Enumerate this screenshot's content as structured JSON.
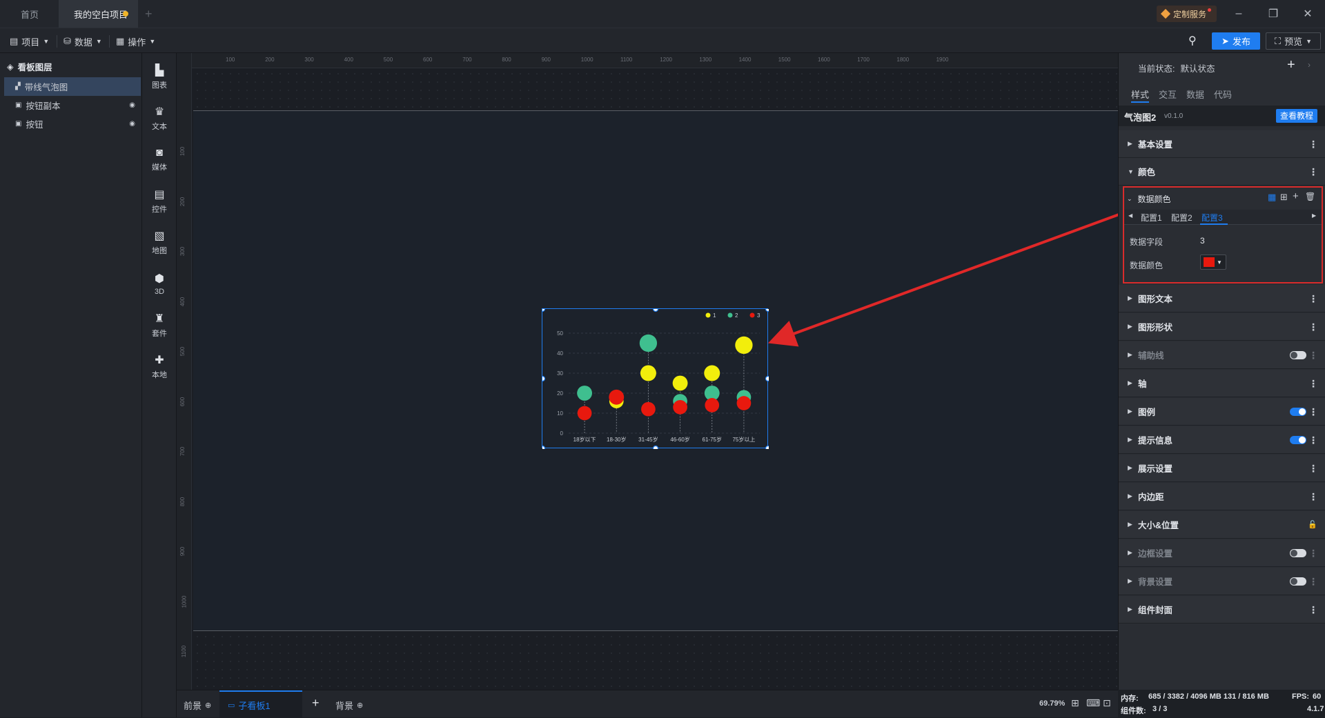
{
  "tabs": [
    {
      "label": "首页"
    },
    {
      "label": "我的空白项目"
    }
  ],
  "titlebar": {
    "custom_service": "定制服务"
  },
  "toolbar": {
    "project": "项目",
    "data": "数据",
    "operation": "操作",
    "publish": "发布",
    "preview": "预览"
  },
  "layers": {
    "title": "看板图层",
    "items": [
      {
        "label": "带线气泡图"
      },
      {
        "label": "按钮副本"
      },
      {
        "label": "按钮"
      }
    ]
  },
  "components": [
    {
      "label": "图表",
      "icon": "bar-chart-icon"
    },
    {
      "label": "文本",
      "icon": "crown-text-icon"
    },
    {
      "label": "媒体",
      "icon": "camera-icon"
    },
    {
      "label": "控件",
      "icon": "control-icon"
    },
    {
      "label": "地图",
      "icon": "map-icon"
    },
    {
      "label": "3D",
      "icon": "cube-icon"
    },
    {
      "label": "套件",
      "icon": "shirt-icon"
    },
    {
      "label": "本地",
      "icon": "puzzle-icon"
    }
  ],
  "ruler": {
    "top": [
      "100",
      "200",
      "300",
      "400",
      "500",
      "600",
      "700",
      "800",
      "900",
      "1000",
      "1100",
      "1200",
      "1300",
      "1400",
      "1500",
      "1600",
      "1700",
      "1800",
      "1900"
    ],
    "left": [
      "100",
      "200",
      "300",
      "400",
      "500",
      "600",
      "700",
      "800",
      "900",
      "1000",
      "1100"
    ]
  },
  "bottom": {
    "foreground": "前景",
    "subboard": "子看板1",
    "background": "背景",
    "zoom": "69.79%"
  },
  "right": {
    "state_label": "当前状态:",
    "state_value": "默认状态",
    "tabs": [
      {
        "label": "样式"
      },
      {
        "label": "交互"
      },
      {
        "label": "数据"
      },
      {
        "label": "代码"
      }
    ],
    "component_name": "气泡图2",
    "version": "v0.1.0",
    "tutorial": "查看教程",
    "sections_top": [
      {
        "label": "基本设置"
      },
      {
        "label": "颜色"
      }
    ],
    "data_color": {
      "title": "数据颜色",
      "configs": [
        {
          "label": "配置1"
        },
        {
          "label": "配置2"
        },
        {
          "label": "配置3"
        }
      ],
      "field_label": "数据字段",
      "field_value": "3",
      "color_label": "数据颜色",
      "color_value": "#e8190e"
    },
    "sections": [
      {
        "label": "图形文本",
        "dim": false,
        "toggle": null
      },
      {
        "label": "图形形状",
        "dim": false,
        "toggle": null
      },
      {
        "label": "辅助线",
        "dim": true,
        "toggle": "off"
      },
      {
        "label": "轴",
        "dim": false,
        "toggle": null
      },
      {
        "label": "图例",
        "dim": false,
        "toggle": "on"
      },
      {
        "label": "提示信息",
        "dim": false,
        "toggle": "on"
      },
      {
        "label": "展示设置",
        "dim": false,
        "toggle": null
      },
      {
        "label": "内边距",
        "dim": false,
        "toggle": null
      },
      {
        "label": "大小&位置",
        "dim": false,
        "toggle": "lock"
      },
      {
        "label": "边框设置",
        "dim": true,
        "toggle": "off"
      },
      {
        "label": "背景设置",
        "dim": true,
        "toggle": "off"
      },
      {
        "label": "组件封面",
        "dim": false,
        "toggle": null
      }
    ]
  },
  "status": {
    "memory_label": "内存:",
    "memory_value": "685 / 3382 / 4096 MB 131 / 816 MB",
    "fps_label": "FPS:",
    "fps_value": "60",
    "count_label": "组件数:",
    "count_value": "3 / 3",
    "version": "4.1.7"
  },
  "colors": {
    "accent": "#1f7df0",
    "series1": "#f2ee0c",
    "series2": "#3fbf8f",
    "series3": "#e8190e",
    "annotation": "#e02828"
  },
  "chart_data": {
    "type": "scatter",
    "categories": [
      "18岁以下",
      "18-30岁",
      "31-45岁",
      "46-60岁",
      "61-75岁",
      "75岁以上"
    ],
    "ylim": [
      0,
      50
    ],
    "yticks": [
      "0",
      "10",
      "20",
      "30",
      "40",
      "50"
    ],
    "legend": [
      {
        "label": "1"
      },
      {
        "label": "2"
      },
      {
        "label": "3"
      }
    ],
    "series": [
      {
        "name": "1",
        "color": "#f2ee0c",
        "values": [
          null,
          16,
          30,
          25,
          30,
          44
        ],
        "sizes": [
          0,
          9,
          10,
          9.5,
          10,
          11
        ]
      },
      {
        "name": "2",
        "color": "#3fbf8f",
        "values": [
          20,
          null,
          45,
          16,
          20,
          18
        ],
        "sizes": [
          9.5,
          0,
          11,
          9,
          9.5,
          9
        ]
      },
      {
        "name": "3",
        "color": "#e8190e",
        "values": [
          10,
          18,
          12,
          13,
          14,
          15
        ],
        "sizes": [
          9,
          9.5,
          9,
          9,
          9,
          9
        ]
      }
    ]
  }
}
